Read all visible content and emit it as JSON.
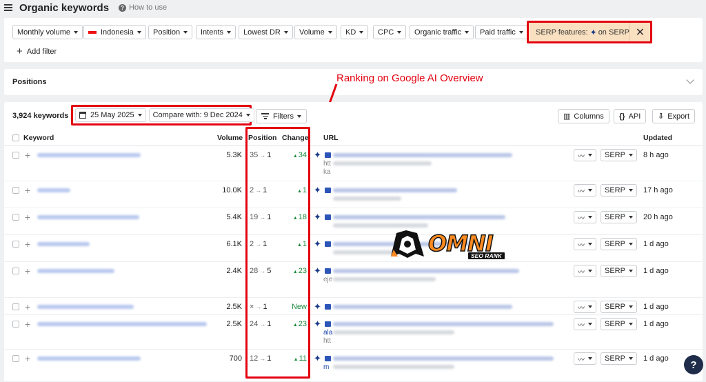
{
  "header": {
    "title": "Organic keywords",
    "how_to": "How to use"
  },
  "filters": [
    {
      "label": "Monthly volume"
    },
    {
      "label": "Indonesia"
    },
    {
      "label": "Position"
    },
    {
      "label": "Intents"
    },
    {
      "label": "Lowest DR"
    },
    {
      "label": "Volume"
    },
    {
      "label": "KD"
    },
    {
      "label": "CPC"
    },
    {
      "label": "Organic traffic"
    },
    {
      "label": "Paid traffic"
    }
  ],
  "serp_features": {
    "label": "SERP features:",
    "value": "on SERP",
    "close": "✕"
  },
  "add_filter": "Add filter",
  "positions_section": {
    "title": "Positions"
  },
  "annotation": "Ranking on Google AI Overview",
  "toolbar": {
    "count": "3,924 keywords",
    "date": "25 May 2025",
    "compare": "Compare with: 9 Dec 2024",
    "filters": "Filters",
    "columns": "Columns",
    "api": "API",
    "export": "Export"
  },
  "table": {
    "headers": {
      "keyword": "Keyword",
      "volume": "Volume",
      "position": "Position",
      "change": "Change",
      "url": "URL",
      "updated": "Updated"
    },
    "serp_label": "SERP",
    "rows": [
      {
        "volume": "5.3K",
        "pos_from": "35",
        "pos_to": "1",
        "change": "34",
        "updated": "8 h ago",
        "url_extra": [
          "htt",
          "ka"
        ]
      },
      {
        "volume": "10.0K",
        "pos_from": "2",
        "pos_to": "1",
        "change": "1",
        "updated": "17 h ago",
        "url_extra": []
      },
      {
        "volume": "5.4K",
        "pos_from": "19",
        "pos_to": "1",
        "change": "18",
        "updated": "20 h ago",
        "url_extra": []
      },
      {
        "volume": "6.1K",
        "pos_from": "2",
        "pos_to": "1",
        "change": "1",
        "updated": "1 d ago",
        "url_extra": []
      },
      {
        "volume": "2.4K",
        "pos_from": "28",
        "pos_to": "5",
        "change": "23",
        "updated": "1 d ago",
        "url_extra": [
          "eje"
        ]
      },
      {
        "volume": "2.5K",
        "pos_from": "×",
        "pos_to": "1",
        "change": "New",
        "updated": "1 d ago",
        "url_extra": []
      },
      {
        "volume": "2.5K",
        "pos_from": "24",
        "pos_to": "1",
        "change": "23",
        "updated": "1 d ago",
        "url_extra": [
          "ala",
          "htt"
        ]
      },
      {
        "volume": "700",
        "pos_from": "12",
        "pos_to": "1",
        "change": "11",
        "updated": "1 d ago",
        "url_extra": [
          "m"
        ]
      }
    ]
  },
  "logo": {
    "name": "OMNI",
    "sub": "SEO RANK"
  },
  "help": "?"
}
